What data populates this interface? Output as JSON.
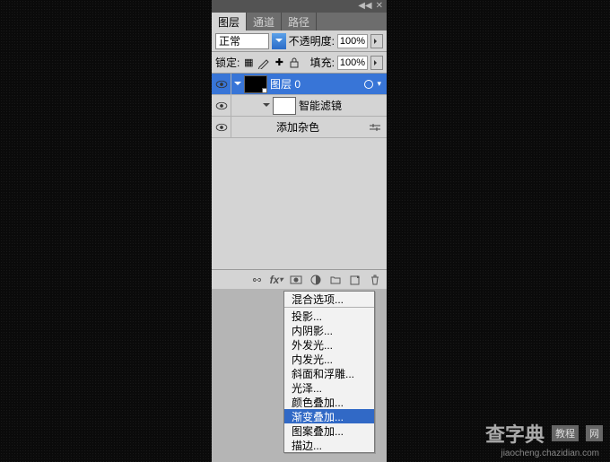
{
  "tabs": [
    "图层",
    "通道",
    "路径"
  ],
  "row1": {
    "blendMode": "正常",
    "opacityLabel": "不透明度:",
    "opacityValue": "100%"
  },
  "row2": {
    "lockLabel": "锁定:",
    "fillLabel": "填充:",
    "fillValue": "100%"
  },
  "layers": {
    "layer0": {
      "name": "图层 0"
    },
    "smartFilters": {
      "name": "智能滤镜"
    },
    "addNoise": {
      "name": "添加杂色"
    }
  },
  "menu": {
    "blendOptions": "混合选项...",
    "dropShadow": "投影...",
    "innerShadow": "内阴影...",
    "outerGlow": "外发光...",
    "innerGlow": "内发光...",
    "bevel": "斜面和浮雕...",
    "satin": "光泽...",
    "colorOverlay": "颜色叠加...",
    "gradientOverlay": "渐变叠加...",
    "patternOverlay": "图案叠加...",
    "stroke": "描边..."
  },
  "watermark": {
    "brand": "查字典",
    "sub1": "教程",
    "sub2": "网",
    "url": "jiaocheng.chazidian.com"
  }
}
